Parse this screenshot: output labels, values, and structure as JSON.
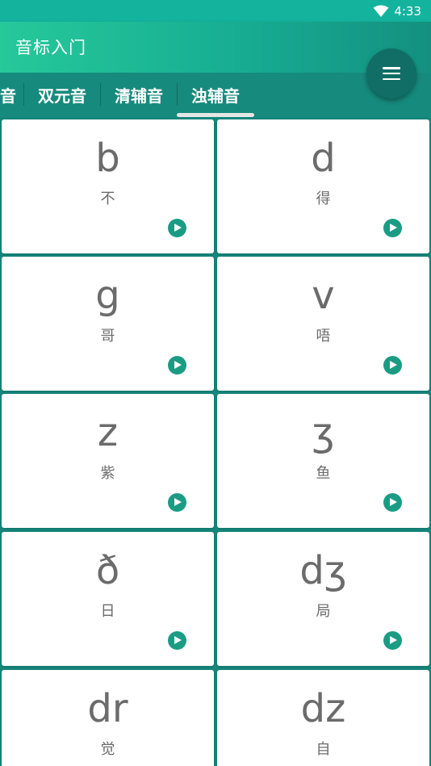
{
  "status": {
    "time": "4:33"
  },
  "app": {
    "title": "音标入门"
  },
  "tabs": [
    {
      "label": "音"
    },
    {
      "label": "双元音"
    },
    {
      "label": "清辅音"
    },
    {
      "label": "浊辅音",
      "active": true
    }
  ],
  "cards": [
    {
      "symbol": "b",
      "hint": "不"
    },
    {
      "symbol": "d",
      "hint": "得"
    },
    {
      "symbol": "g",
      "hint": "哥"
    },
    {
      "symbol": "v",
      "hint": "唔"
    },
    {
      "symbol": "z",
      "hint": "紫"
    },
    {
      "symbol": "ʒ",
      "hint": "鱼"
    },
    {
      "symbol": "ð",
      "hint": "日"
    },
    {
      "symbol": "dʒ",
      "hint": "局"
    },
    {
      "symbol": "dr",
      "hint": "觉"
    },
    {
      "symbol": "dz",
      "hint": "自"
    }
  ],
  "icons": {
    "status": "wifi-icon",
    "fab": "menu-icon",
    "card_action": "play-icon"
  },
  "colors": {
    "accent": "#1a9c84",
    "appbar_start": "#26c99a",
    "tabbar": "#168a7d",
    "fab": "#106e66"
  }
}
